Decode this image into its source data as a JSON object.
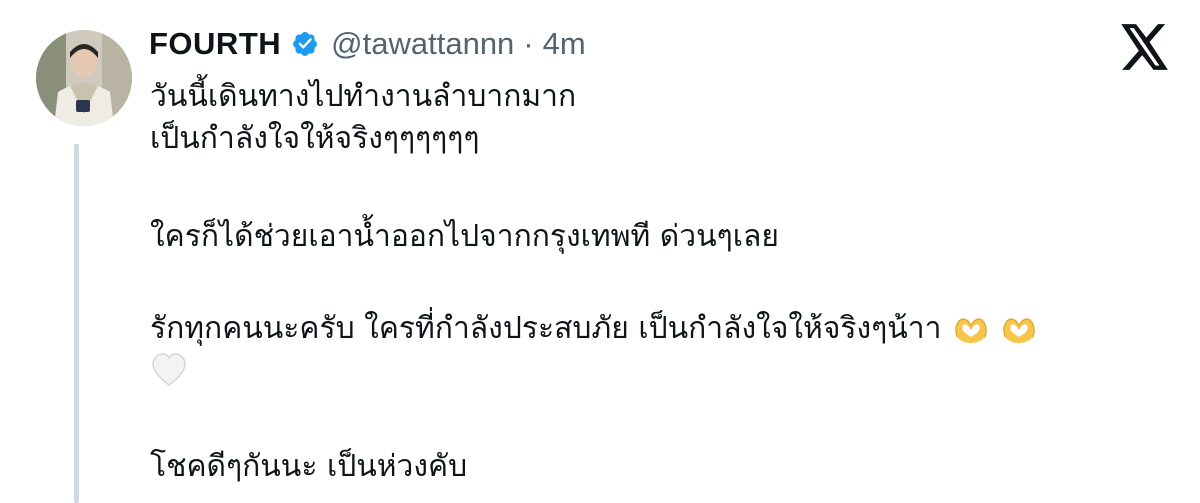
{
  "user": {
    "display_name": "FOURTH",
    "handle": "@tawattannn",
    "separator": "·",
    "timestamp": "4m"
  },
  "icons": {
    "verified": "verified-badge-icon",
    "logo": "x-logo-icon",
    "emoji_heart_hands": "heart-hands-emoji",
    "emoji_white_heart": "white-heart-emoji"
  },
  "colors": {
    "verified_blue": "#1d9bf0",
    "thread_line": "#cfd9de",
    "secondary_text": "#536471"
  },
  "tweet": {
    "line1": "วันนี้เดินทางไปทำงานลำบากมาก",
    "line2": "เป็นกำลังใจให้จริงๆๆๆๆๆๆ",
    "line3": "ใครก็ได้ช่วยเอาน้ำออกไปจากกรุงเทพที ด่วนๆเลย",
    "line4": "รักทุกคนนะครับ ใครที่กำลังประสบภัย เป็นกำลังใจให้จริงๆน้าา",
    "line5": "โชคดีๆกันนะ เป็นห่วงคับ"
  }
}
